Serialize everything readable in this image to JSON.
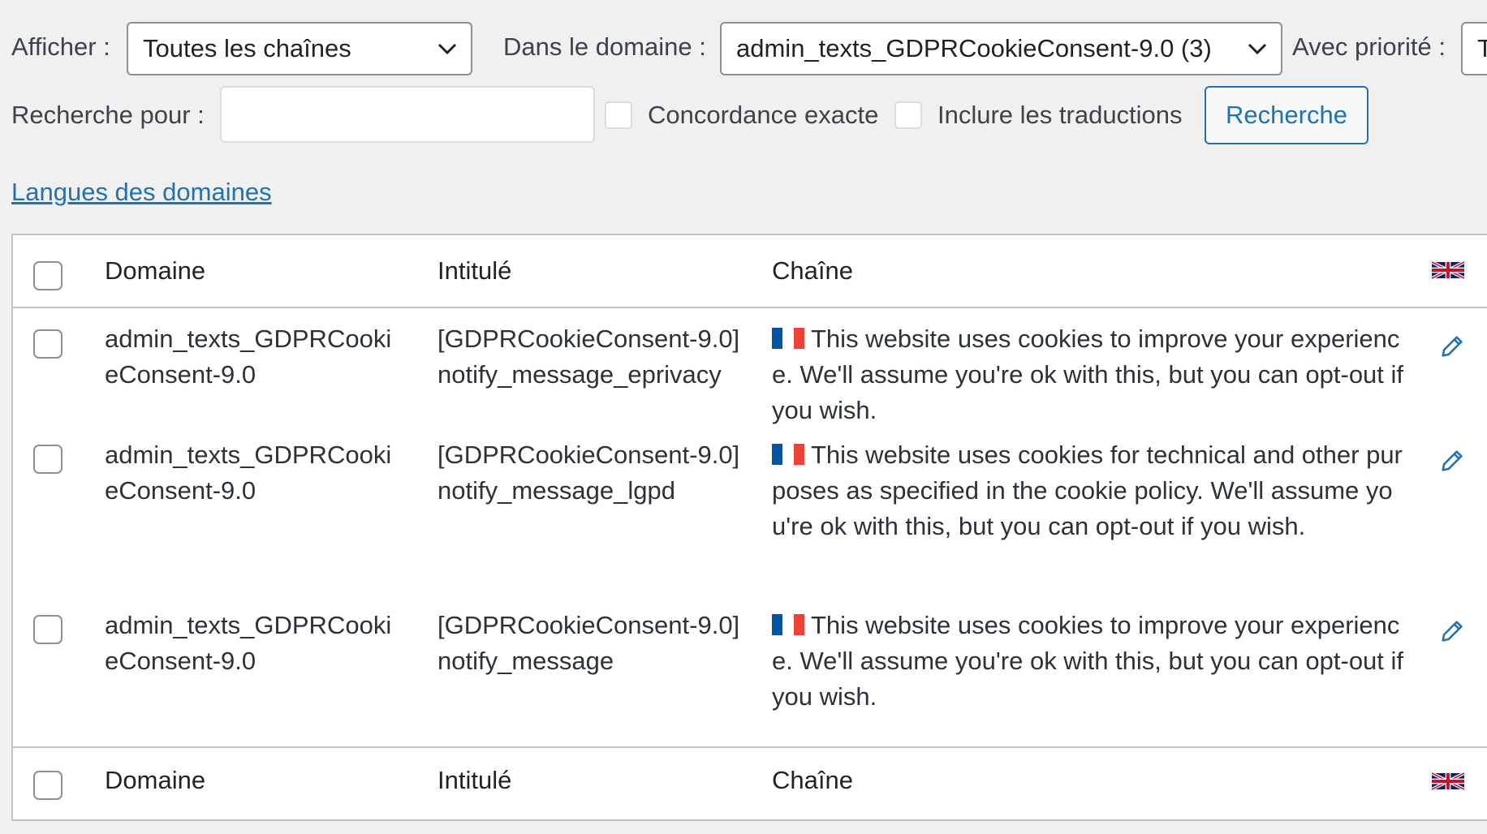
{
  "filters": {
    "show_label": "Afficher :",
    "show_value": "Toutes les chaînes",
    "domain_label": "Dans le domaine :",
    "domain_value": "admin_texts_GDPRCookieConsent-9.0 (3)",
    "priority_label": "Avec priorité :",
    "priority_value": "T",
    "search_label": "Recherche pour :",
    "search_value": "",
    "exact_match_label": "Concordance exacte",
    "include_translations_label": "Inclure les traductions",
    "search_button": "Recherche"
  },
  "domain_languages_link": "Langues des domaines",
  "table": {
    "headers": {
      "domain": "Domaine",
      "title": "Intitulé",
      "string": "Chaîne"
    },
    "rows": [
      {
        "domain": "admin_texts_GDPRCookieConsent-9.0",
        "title": "[GDPRCookieConsent-9.0]notify_message_eprivacy",
        "string": "This website uses cookies to improve your experience. We'll assume you're ok with this, but you can opt-out if you wish."
      },
      {
        "domain": "admin_texts_GDPRCookieConsent-9.0",
        "title": "[GDPRCookieConsent-9.0]notify_message_lgpd",
        "string": "This website uses cookies for technical and other purposes as specified in the cookie policy. We'll assume you're ok with this, but you can opt-out if you wish."
      },
      {
        "domain": "admin_texts_GDPRCookieConsent-9.0",
        "title": "[GDPRCookieConsent-9.0]notify_message",
        "string": "This website uses cookies to improve your experience. We'll assume you're ok with this, but you can opt-out if you wish."
      }
    ]
  },
  "icons": {
    "row_language_flag": "france-flag-icon",
    "column_language_flag": "uk-flag-icon",
    "edit": "pencil-icon"
  },
  "colors": {
    "accent": "#2271b1",
    "background": "#f0f0f1"
  }
}
